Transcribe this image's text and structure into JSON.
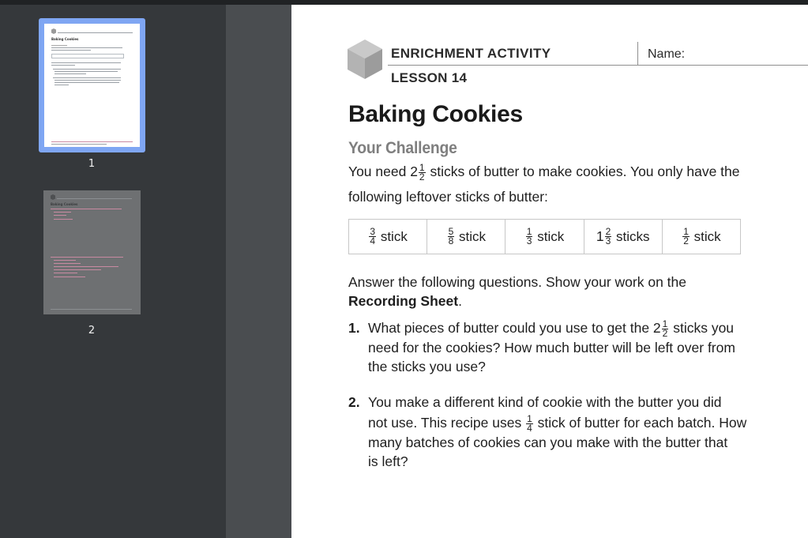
{
  "sidebar": {
    "pages": [
      {
        "label": "1",
        "selected": true
      },
      {
        "label": "2",
        "selected": false
      }
    ]
  },
  "thumbnail_text": {
    "page1_title": "Baking Cookies",
    "page2_title": "Baking Cookies"
  },
  "worksheet": {
    "header": {
      "activity": "ENRICHMENT ACTIVITY",
      "name_label": "Name:",
      "lesson": "LESSON 14"
    },
    "title": "Baking Cookies",
    "section_heading": "Your Challenge",
    "intro": {
      "before_fraction": "You need ",
      "whole": "2",
      "num": "1",
      "den": "2",
      "after_fraction": " sticks of butter to make cookies. You only have the",
      "line2": "following leftover sticks of butter:"
    },
    "sticks": [
      {
        "whole": "",
        "num": "3",
        "den": "4",
        "unit": "stick"
      },
      {
        "whole": "",
        "num": "5",
        "den": "8",
        "unit": "stick"
      },
      {
        "whole": "",
        "num": "1",
        "den": "3",
        "unit": "stick"
      },
      {
        "whole": "1",
        "num": "2",
        "den": "3",
        "unit": "sticks"
      },
      {
        "whole": "",
        "num": "1",
        "den": "2",
        "unit": "stick"
      }
    ],
    "instructions": {
      "line1": "Answer the following questions. Show your work on the",
      "bold": "Recording Sheet",
      "end": "."
    },
    "questions": [
      {
        "number": "1.",
        "line1_before": "What pieces of butter could you use to get the ",
        "whole": "2",
        "num": "1",
        "den": "2",
        "line1_after": " sticks you",
        "line2": "need for the cookies? How much butter will be left over from",
        "line3": "the sticks you use?"
      },
      {
        "number": "2.",
        "line1": "You make a different kind of cookie with the butter you did",
        "line2_before": "not use. This recipe uses ",
        "num": "1",
        "den": "4",
        "line2_after": " stick of butter for each batch. How",
        "line3": "many batches of cookies can you make with the butter that",
        "line4": "is left?"
      }
    ]
  },
  "colors": {
    "sidebar_bg": "#35383b",
    "gutter_bg": "#4a4d50",
    "selection": "#7fa6f3",
    "page_bg": "#ffffff",
    "heading_gray": "#7f7f7f"
  }
}
